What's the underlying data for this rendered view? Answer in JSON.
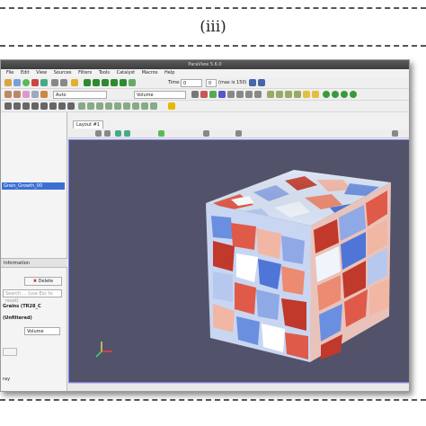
{
  "figure": {
    "panel_label": "(iii)"
  },
  "window": {
    "title": "ParaView 5.6.0"
  },
  "menu": [
    "File",
    "Edit",
    "View",
    "Sources",
    "Filters",
    "Tools",
    "Catalyst",
    "Macros",
    "Help"
  ],
  "toolbar": {
    "time_label": "Time:",
    "time_value": "0",
    "time_index": "0",
    "max_label": "(max is 150)",
    "color_array": "Auto",
    "representation": "Volume"
  },
  "pipeline": {
    "selected_item": "Grain_Growth_00"
  },
  "properties": {
    "tab_label": "Information",
    "delete_label": "Delete",
    "search_placeholder": "Search ... (use Esc to reset)",
    "array_label": "Grains (TR28_C",
    "sel_label": "(Unfiltered)",
    "representation_value": "Volume",
    "ray_label": "ray",
    "field_value_1": "0",
    "field_value_2": "100",
    "level_label": "ing",
    "scaling_label": "aling",
    "mode_value": "Smart"
  },
  "view": {
    "tab_label": "Layout #1"
  },
  "colors": {
    "render_bg": "#52526a",
    "selection": "#3b6fd4",
    "cube_high": "#c0392b",
    "cube_low": "#6a8fe0"
  }
}
